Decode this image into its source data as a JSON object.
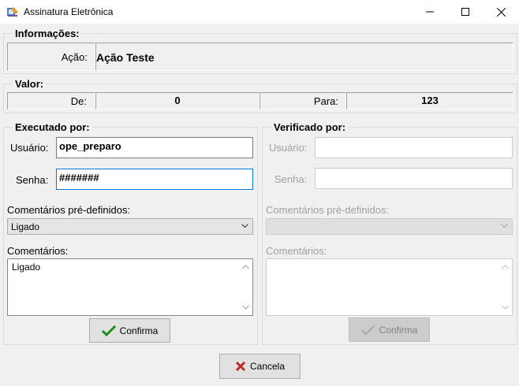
{
  "window": {
    "title": "Assinatura Eletrônica",
    "icon": "app-signature-icon"
  },
  "informacoes": {
    "label": "Informações:",
    "acao_label": "Ação:",
    "acao_value": "Ação Teste"
  },
  "valor": {
    "label": "Valor:",
    "de_label": "De:",
    "de_value": "0",
    "para_label": "Para:",
    "para_value": "123"
  },
  "executado": {
    "label": "Executado por:",
    "usuario_label": "Usuário:",
    "usuario_value": "ope_preparo",
    "senha_label": "Senha:",
    "senha_value": "#######",
    "predef_label": "Comentários pré-definidos:",
    "predef_value": "Ligado",
    "comentarios_label": "Comentários:",
    "comentarios_value": "Ligado",
    "confirm_label": "Confirma"
  },
  "verificado": {
    "label": "Verificado por:",
    "usuario_label": "Usuário:",
    "usuario_value": "",
    "senha_label": "Senha:",
    "senha_value": "",
    "predef_label": "Comentários pré-definidos:",
    "predef_value": "",
    "comentarios_label": "Comentários:",
    "comentarios_value": "",
    "confirm_label": "Confirma"
  },
  "cancel_label": "Cancela",
  "colors": {
    "check": "#1e8c1e",
    "cancel_x": "#c0262c",
    "focus_border": "#0078d7"
  }
}
